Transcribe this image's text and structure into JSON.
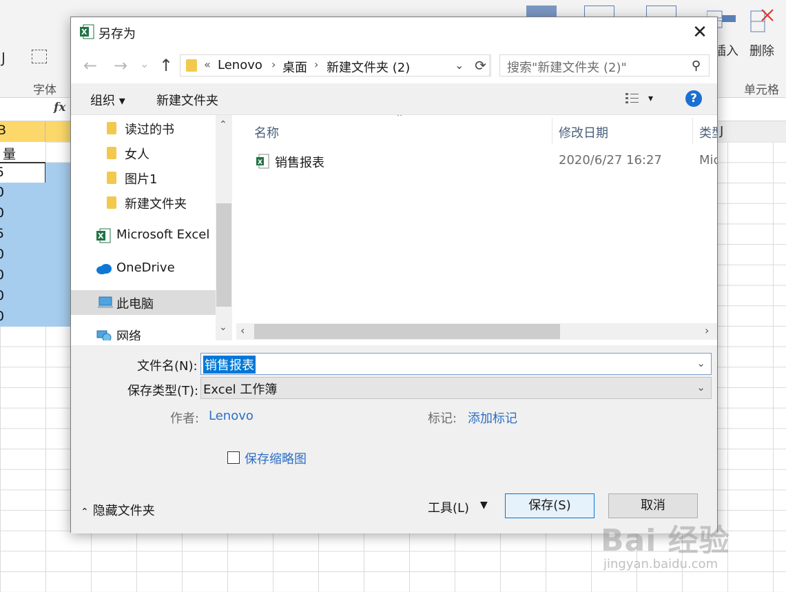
{
  "excel": {
    "ribbon_fragments": [
      "J",
      "插入",
      "删除",
      "单元格",
      "字体"
    ],
    "cells": [
      "B",
      "量",
      "5",
      "0",
      "0",
      "5",
      "0",
      "0",
      "0",
      "0"
    ],
    "fx_label": "fx",
    "right_col_header": "J"
  },
  "dialog": {
    "title": "另存为",
    "close_symbol": "✕",
    "nav": {
      "back": "←",
      "forward": "→",
      "dropdown": "⌄",
      "up": "↑"
    },
    "address": {
      "overflow": "«",
      "crumbs": [
        "Lenovo",
        "桌面",
        "新建文件夹 (2)"
      ],
      "refresh": "⟳"
    },
    "search": {
      "placeholder": "搜索\"新建文件夹 (2)\""
    },
    "toolbar": {
      "organize": "组织 ▾",
      "new_folder": "新建文件夹",
      "view_dd": "▾",
      "help": "?"
    },
    "nav_pane": {
      "items": [
        {
          "label": "读过的书",
          "icon": "folder-icon"
        },
        {
          "label": "女人",
          "icon": "folder-icon"
        },
        {
          "label": "图片1",
          "icon": "folder-icon"
        },
        {
          "label": "新建文件夹",
          "icon": "folder-icon"
        },
        {
          "label": "Microsoft Excel",
          "icon": "excel-icon"
        },
        {
          "label": "OneDrive",
          "icon": "cloud-icon"
        },
        {
          "label": "此电脑",
          "icon": "computer-icon",
          "selected": true
        },
        {
          "label": "网络",
          "icon": "network-icon"
        }
      ]
    },
    "file_list": {
      "columns": [
        "名称",
        "修改日期",
        "类型"
      ],
      "rows": [
        {
          "name": "销售报表",
          "modified": "2020/6/27 16:27",
          "type": "Mic"
        }
      ]
    },
    "form": {
      "filename_label": "文件名(N):",
      "filename_value": "销售报表",
      "type_label": "保存类型(T):",
      "type_value": "Excel 工作簿",
      "author_label": "作者:",
      "author_value": "Lenovo",
      "tags_label": "标记:",
      "tags_value": "添加标记",
      "thumbnail_label": "保存缩略图"
    },
    "footer": {
      "hide_folders": "隐藏文件夹",
      "tools": "工具(L)",
      "save": "保存(S)",
      "cancel": "取消"
    }
  },
  "watermark": {
    "main": "Bai 经验",
    "sub": "jingyan.baidu.com"
  },
  "colors": {
    "accent": "#0078d7",
    "link": "#2d6fc4",
    "selection": "#a6cdee",
    "header_yellow": "#fcd86b"
  }
}
